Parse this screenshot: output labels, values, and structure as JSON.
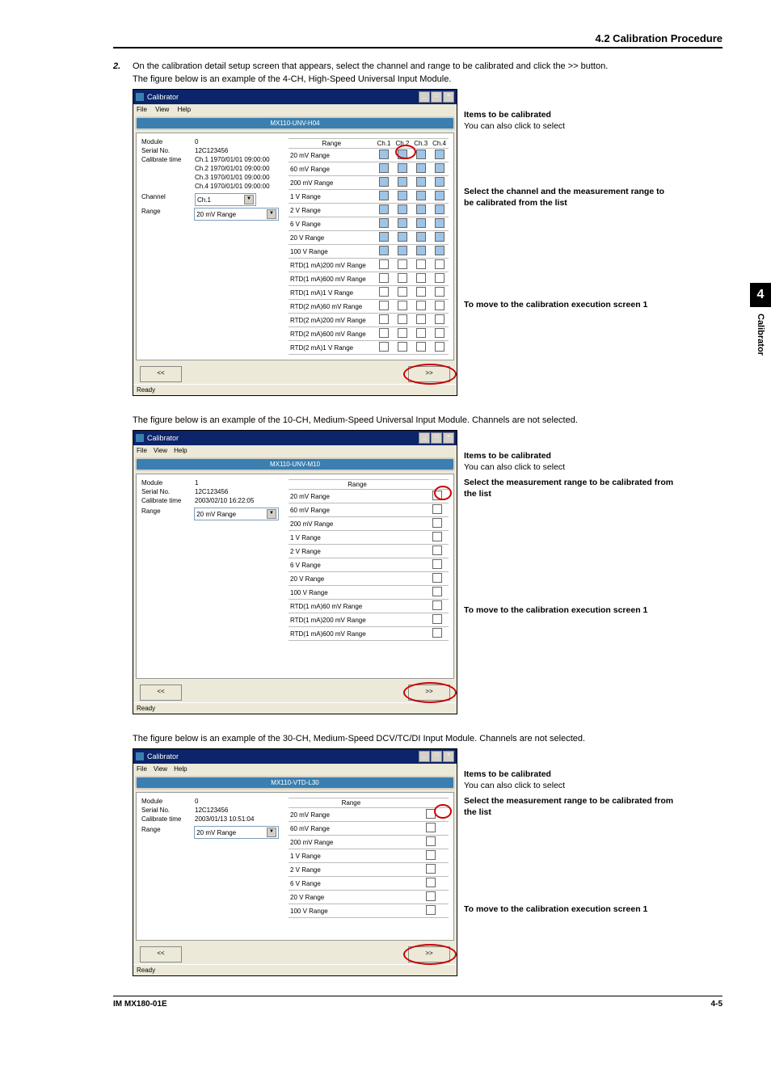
{
  "page": {
    "header": "4.2  Calibration Procedure",
    "footer_left": "IM MX180-01E",
    "footer_right": "4-5"
  },
  "sidebar": {
    "num": "4",
    "label": "Calibrator"
  },
  "body": {
    "step_num": "2.",
    "step_text": "On the calibration detail setup screen that appears, select the channel and range to be calibrated and click the >> button.",
    "fig1_intro": "The figure below is an example of the 4-CH, High-Speed Universal Input Module.",
    "fig2_intro": "The figure below is an example of the 10-CH, Medium-Speed Universal Input Module. Channels are not selected.",
    "fig3_intro": "The figure below is an example of the 30-CH, Medium-Speed DCV/TC/DI Input Module. Channels are not selected."
  },
  "window": {
    "title": "Calibrator",
    "menu_file": "File",
    "menu_view": "View",
    "menu_help": "Help",
    "status": "Ready",
    "prev": "<<",
    "next": ">>",
    "dd_arrow": "▼"
  },
  "labels": {
    "module": "Module",
    "serial": "Serial No.",
    "caltime": "Calibrate time",
    "channel": "Channel",
    "range": "Range",
    "range_col": "Range"
  },
  "fig1": {
    "band": "MX110-UNV-H04",
    "module_val": "0",
    "serial_val": "12C123456",
    "ct": [
      {
        "ch": "Ch.1",
        "v": "1970/01/01 09:00:00"
      },
      {
        "ch": "Ch.2",
        "v": "1970/01/01 09:00:00"
      },
      {
        "ch": "Ch.3",
        "v": "1970/01/01 09:00:00"
      },
      {
        "ch": "Ch.4",
        "v": "1970/01/01 09:00:00"
      }
    ],
    "channel_val": "Ch.1",
    "range_val": "20 mV Range",
    "ch_head": [
      "Ch.1",
      "Ch.2",
      "Ch.3",
      "Ch.4"
    ],
    "ranges": [
      "20 mV Range",
      "60 mV Range",
      "200 mV Range",
      "1 V Range",
      "2 V Range",
      "6 V Range",
      "20 V Range",
      "100 V Range",
      "RTD(1 mA)200 mV Range",
      "RTD(1 mA)600 mV Range",
      "RTD(1 mA)1 V Range",
      "RTD(2 mA)60 mV Range",
      "RTD(2 mA)200 mV Range",
      "RTD(2 mA)600 mV Range",
      "RTD(2 mA)1 V Range"
    ],
    "callouts": {
      "a": {
        "title": "Items to be calibrated",
        "text": "You can also click to select"
      },
      "b": {
        "title": "Select the channel and the measurement range to be calibrated from the list",
        "text": ""
      },
      "c": {
        "title": "To move to the calibration execution screen 1",
        "text": ""
      }
    }
  },
  "fig2": {
    "band": "MX110-UNV-M10",
    "module_val": "1",
    "serial_val": "12C123456",
    "caltime_val": "2003/02/10 16:22:05",
    "range_val": "20 mV Range",
    "ranges": [
      "20 mV Range",
      "60 mV Range",
      "200 mV Range",
      "1 V Range",
      "2 V Range",
      "6 V Range",
      "20 V Range",
      "100 V Range",
      "RTD(1 mA)60 mV Range",
      "RTD(1 mA)200 mV Range",
      "RTD(1 mA)600 mV Range"
    ],
    "callouts": {
      "a": {
        "title": "Items to be calibrated",
        "text": "You can also click to select"
      },
      "b": {
        "title": "Select the measurement range to be calibrated from the list",
        "text": ""
      },
      "c": {
        "title": "To move to the calibration execution screen 1",
        "text": ""
      }
    }
  },
  "fig3": {
    "band": "MX110-VTD-L30",
    "module_val": "0",
    "serial_val": "12C123456",
    "caltime_val": "2003/01/13 10:51:04",
    "range_val": "20 mV Range",
    "ranges": [
      "20 mV Range",
      "60 mV Range",
      "200 mV Range",
      "1 V Range",
      "2 V Range",
      "6 V Range",
      "20 V Range",
      "100 V Range"
    ],
    "callouts": {
      "a": {
        "title": "Items to be calibrated",
        "text": "You can also click to select"
      },
      "b": {
        "title": "Select the measurement range to be calibrated from the list",
        "text": ""
      },
      "c": {
        "title": "To move to the calibration execution screen 1",
        "text": ""
      }
    }
  }
}
